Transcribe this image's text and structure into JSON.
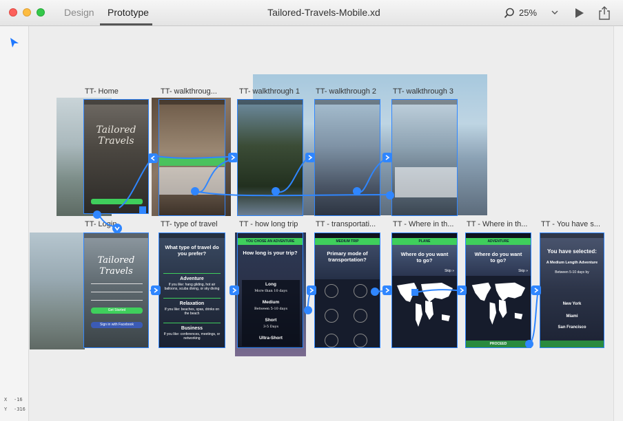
{
  "window": {
    "title": "Tailored-Travels-Mobile.xd",
    "mode_tabs": [
      "Design",
      "Prototype"
    ],
    "active_tab": "Prototype",
    "zoom": "25%"
  },
  "cursor": {
    "x_label": "X",
    "x_value": "-16",
    "y_label": "Y",
    "y_value": "-316"
  },
  "colors": {
    "accent": "#2f86ff",
    "brand_green": "#3fcf5c",
    "dark_screen": "#161c2c"
  },
  "artboards_row1": [
    "TT- Home",
    "TT- walkthroug...",
    "TT- walkthrough 1",
    "TT- walkthrough 2",
    "TT- walkthrough 3"
  ],
  "artboards_row2": [
    "TT- Login",
    "TT- type of travel",
    "TT - how long trip",
    "TT - transportati...",
    "TT - Where in th...",
    "TT - Where in th...",
    "TT - You have s..."
  ],
  "screens": {
    "login": {
      "logo_line1": "Tailored",
      "logo_line2": "Travels",
      "get_started": "Get Started",
      "facebook": "Sign in with Facebook"
    },
    "type_of_travel": {
      "question": "What type of travel do you prefer?",
      "options": [
        "Adventure",
        "Relaxation",
        "Business"
      ],
      "option_descs": [
        "If you like: hang gliding, hot air balloons, scuba diving, or sky diving",
        "If you like: beaches, spas, drinks on the beach",
        "If you like: conferences, meetings, or networking"
      ]
    },
    "how_long": {
      "header": "YOU CHOSE AN ADVENTURE",
      "question": "How long is your trip?",
      "options": [
        "Long",
        "Medium",
        "Short",
        "Ultra-Short"
      ],
      "durations": [
        "More than 10 days",
        "Between 5-10 days",
        "3-5 Days"
      ]
    },
    "transportation": {
      "header": "MEDIUM TRIP",
      "question": "Primary mode of transportation?"
    },
    "where1": {
      "header": "PLANE",
      "question": "Where do you want to go?",
      "skip": "Skip »"
    },
    "where2": {
      "header": "ADVENTURE",
      "question": "Where do you want to go?",
      "skip": "Skip »",
      "proceed": "PROCEED"
    },
    "selected": {
      "title": "You have selected:",
      "subtitle": "A Medium Length Adventure",
      "days": "Between 5-10 days by",
      "cities": [
        "New York",
        "Miami",
        "San Francisco"
      ]
    },
    "home": {
      "logo_line1": "Tailored",
      "logo_line2": "Travels"
    }
  }
}
